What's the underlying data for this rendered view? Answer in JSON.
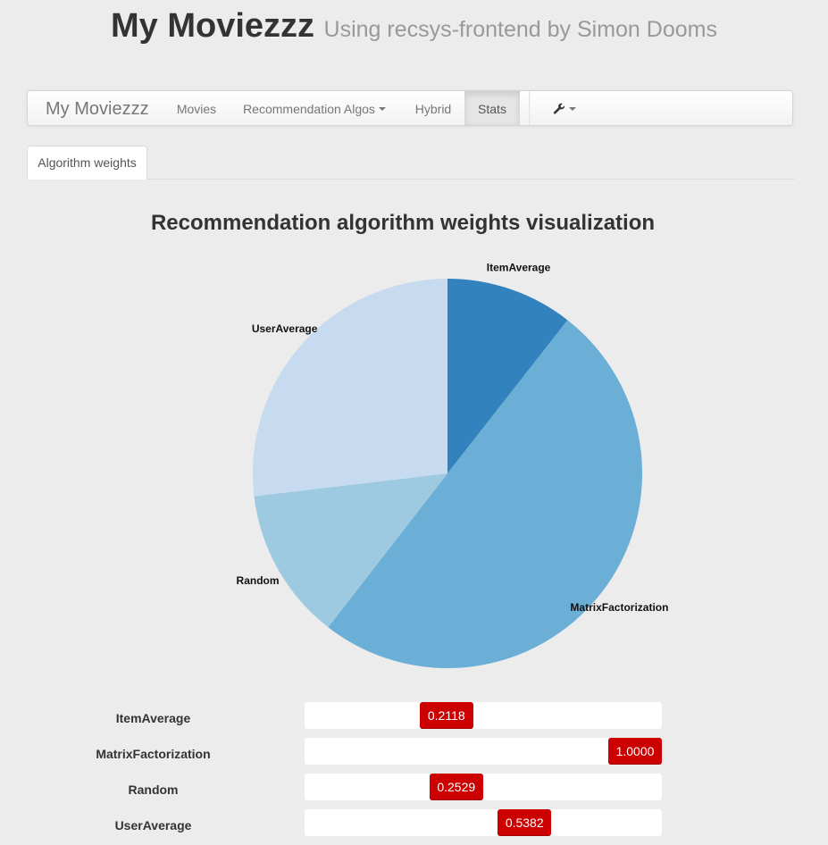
{
  "header": {
    "title": "My Moviezzz",
    "subtitle": "Using recsys-frontend by Simon Dooms"
  },
  "navbar": {
    "brand": "My Moviezzz",
    "items": [
      {
        "label": "Movies"
      },
      {
        "label": "Recommendation Algos"
      },
      {
        "label": "Hybrid"
      },
      {
        "label": "Stats"
      }
    ],
    "active": "Stats"
  },
  "tabs": [
    {
      "label": "Algorithm weights"
    }
  ],
  "visualization": {
    "title": "Recommendation algorithm weights visualization"
  },
  "colors": {
    "accent": "#cc0000",
    "pie": [
      "#3182bd",
      "#6baed6",
      "#9ecae1",
      "#c6dbef"
    ]
  },
  "chart_data": {
    "type": "pie",
    "title": "Recommendation algorithm weights visualization",
    "categories": [
      "ItemAverage",
      "MatrixFactorization",
      "Random",
      "UserAverage"
    ],
    "values": [
      0.2118,
      1.0,
      0.2529,
      0.5382
    ]
  },
  "weights": [
    {
      "name": "ItemAverage",
      "value": "0.2118",
      "fraction": 0.2118
    },
    {
      "name": "MatrixFactorization",
      "value": "1.0000",
      "fraction": 1.0
    },
    {
      "name": "Random",
      "value": "0.2529",
      "fraction": 0.2529
    },
    {
      "name": "UserAverage",
      "value": "0.5382",
      "fraction": 0.5382
    }
  ]
}
